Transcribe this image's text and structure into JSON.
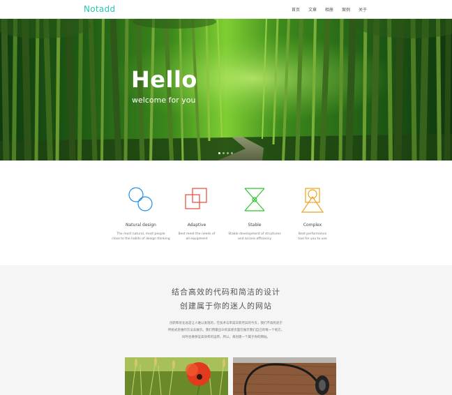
{
  "header": {
    "logo": "Notadd",
    "nav": [
      "首页",
      "文章",
      "相册",
      "案例",
      "关于"
    ]
  },
  "hero": {
    "title": "Hello",
    "subtitle": "welcome for you",
    "slide_count": 4,
    "active_slide": 1
  },
  "features": [
    {
      "icon": "two-circles-icon",
      "color": "#1e90e8",
      "title": "Natural design",
      "desc": [
        "The most natural, most people",
        "close to the habits of design thinking"
      ]
    },
    {
      "icon": "overlapping-squares-icon",
      "color": "#e8483a",
      "title": "Adaptive",
      "desc": [
        "Best meet the needs of",
        "all equipment"
      ]
    },
    {
      "icon": "hourglass-icon",
      "color": "#2ec52e",
      "title": "Stable",
      "desc": [
        "Stable development of structures",
        "and access efficiency"
      ]
    },
    {
      "icon": "triangle-square-icon",
      "color": "#f0a21c",
      "title": "Complex",
      "desc": [
        "Best performance",
        "tool for you to use"
      ]
    }
  ],
  "section": {
    "slogan_line1": "结合高效的代码和简洁的设计",
    "slogan_line2": "创建属于你的迷人的网站",
    "paragraph": [
      "创新和优化总是让人难以发现的，在技术与审美日新月异的今天，我们不再拘泥于",
      "传统式思维的方法去展示。我们用最出众的美感页面在展示我们自己的每一个地方，",
      "同时也要保证高效率的运转。所以，来创建一个属于你的网站。"
    ]
  }
}
